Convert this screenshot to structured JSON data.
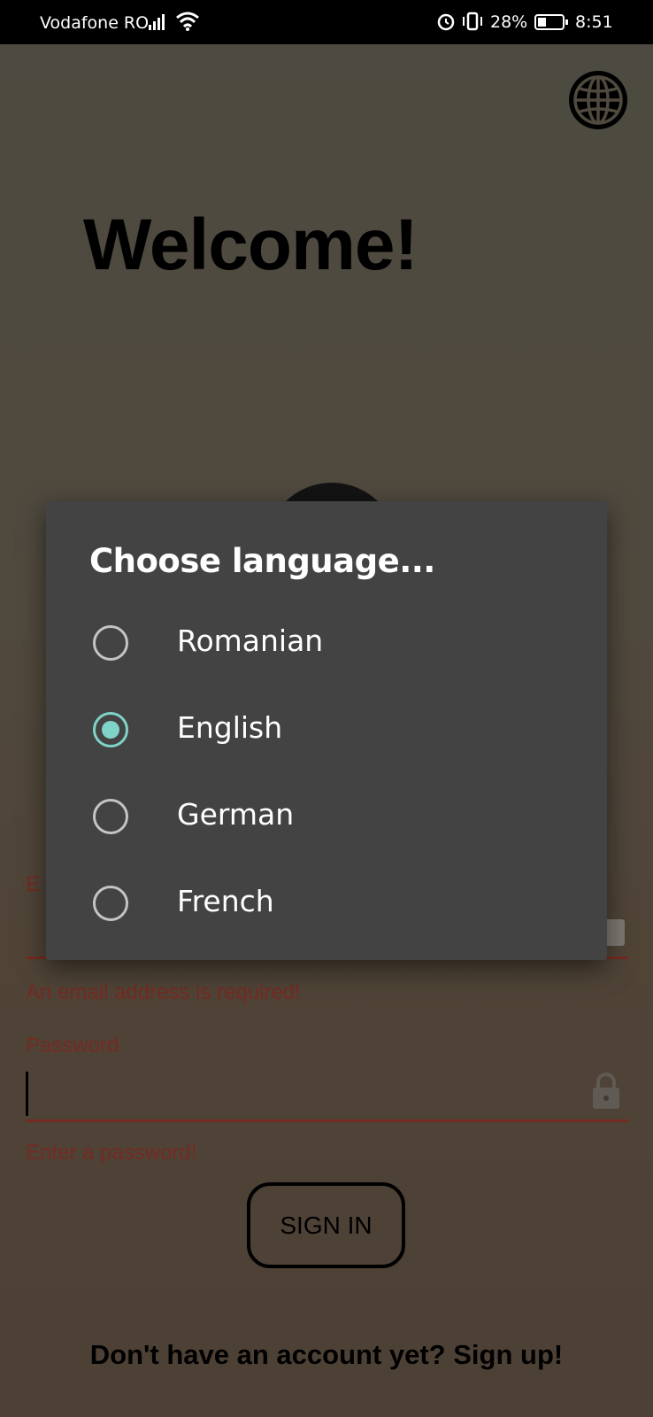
{
  "status_bar": {
    "carrier": "Vodafone RO",
    "battery_percent": "28%",
    "time": "8:51"
  },
  "screen": {
    "welcome_title": "Welcome!",
    "email": {
      "label": "E",
      "error": "An email address is required!"
    },
    "password": {
      "label": "Password",
      "value": "",
      "error": "Enter a password!"
    },
    "sign_in_label": "SIGN IN",
    "sign_up_prompt": "Don't have an account yet? Sign up!"
  },
  "dialog": {
    "title": "Choose language...",
    "options": [
      {
        "label": "Romanian",
        "selected": false
      },
      {
        "label": "English",
        "selected": true
      },
      {
        "label": "German",
        "selected": false
      },
      {
        "label": "French",
        "selected": false
      }
    ]
  },
  "colors": {
    "error": "#c84a3a",
    "dialog_bg": "#434343",
    "radio_accent": "#7fd3c9"
  },
  "icons": [
    "globe-icon",
    "lock-icon",
    "email-icon",
    "signal-icon",
    "wifi-icon",
    "alarm-icon",
    "vibrate-icon",
    "battery-icon"
  ]
}
